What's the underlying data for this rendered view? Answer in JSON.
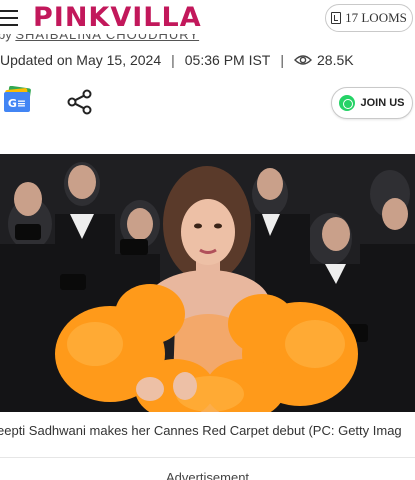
{
  "header": {
    "logo_text": "PINKVILLA",
    "looms_label": "17 LOOMS",
    "brand_color": "#c2185b"
  },
  "byline": {
    "prefix": "by",
    "author": "SHAIBALINA CHOUDHURY"
  },
  "meta": {
    "updated": "Updated on May 15, 2024",
    "time": "05:36 PM IST",
    "views": "28.5K"
  },
  "actions": {
    "google_news_icon": "google-news-icon",
    "share_icon": "share-icon",
    "join_label": "JOIN US",
    "whatsapp_color": "#25d366"
  },
  "hero": {
    "image_label": "Deepti Sadhwani Cannes red carpet photo"
  },
  "caption": "eepti Sadhwani makes her Cannes Red Carpet debut (PC: Getty Imag",
  "ad_label": "Advertisement"
}
